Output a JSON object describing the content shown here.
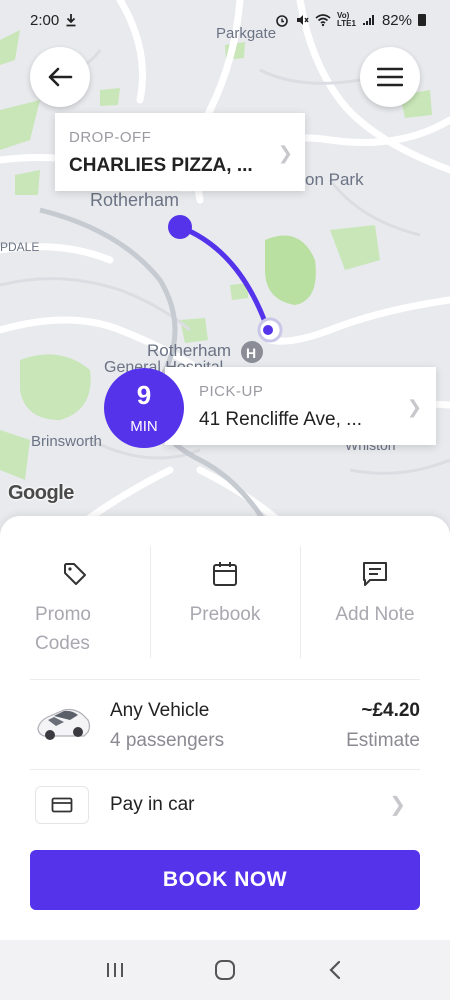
{
  "status_bar": {
    "time": "2:00",
    "battery": "82%"
  },
  "map": {
    "labels": {
      "parkgate": "Parkgate",
      "rotherham": "Rotherham",
      "park": "on Park",
      "pdale": "PDALE",
      "rotherham_h": "Rotherham",
      "general_hospital": "General Hospital",
      "brinsworth": "Brinsworth",
      "whiston": "Whiston"
    },
    "google_logo": "Google",
    "route_color": "#5433eb"
  },
  "dropoff": {
    "label": "DROP-OFF",
    "value": "CHARLIES PIZZA, ..."
  },
  "pickup": {
    "label": "PICK-UP",
    "value": "41 Rencliffe Ave, ..."
  },
  "eta": {
    "minutes": "9",
    "unit": "MIN"
  },
  "actions": [
    {
      "label_line1": "Promo",
      "label_line2": "Codes",
      "icon": "tag-icon"
    },
    {
      "label": "Prebook",
      "icon": "calendar-icon"
    },
    {
      "label": "Add Note",
      "icon": "message-icon"
    }
  ],
  "vehicle": {
    "name": "Any Vehicle",
    "passengers": "4 passengers",
    "price": "~£4.20",
    "price_note": "Estimate"
  },
  "payment": {
    "label": "Pay in car",
    "icon": "credit-card-icon"
  },
  "book_button": "BOOK NOW",
  "accent_color": "#5433eb"
}
